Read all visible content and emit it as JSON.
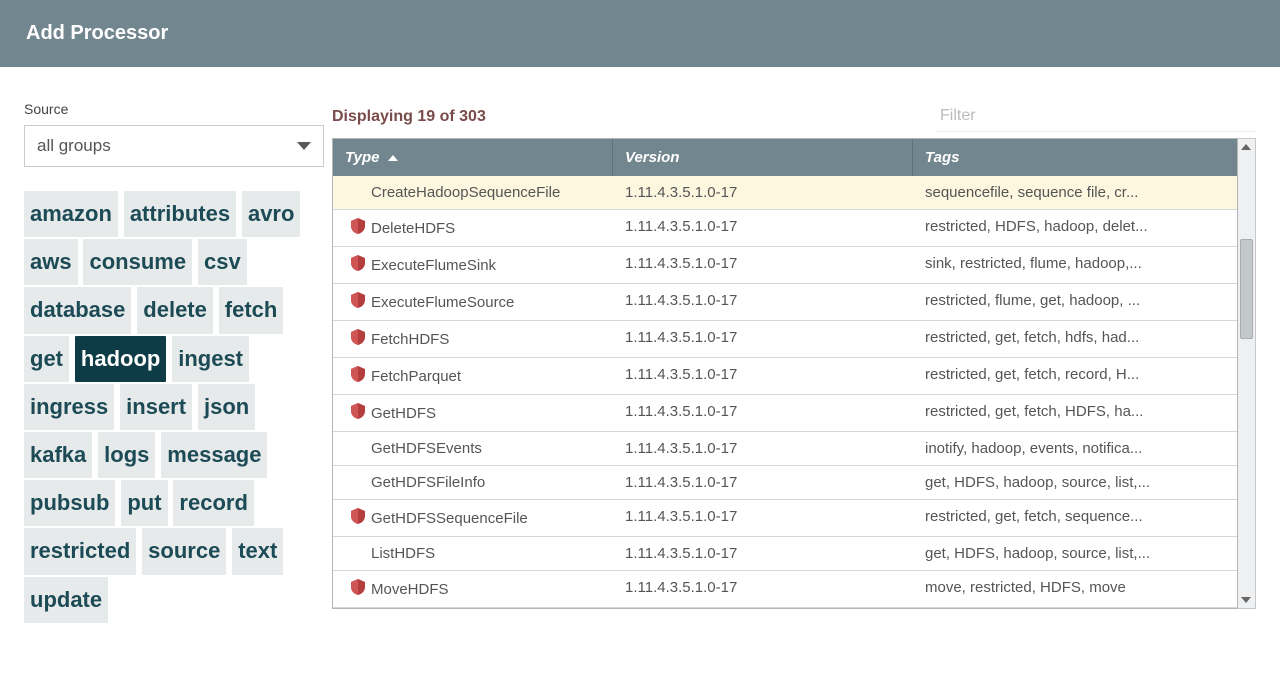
{
  "header": {
    "title": "Add Processor"
  },
  "source": {
    "label": "Source",
    "selected": "all groups"
  },
  "tag_cloud": [
    {
      "label": "amazon",
      "selected": false
    },
    {
      "label": "attributes",
      "selected": false
    },
    {
      "label": "avro",
      "selected": false
    },
    {
      "label": "aws",
      "selected": false
    },
    {
      "label": "consume",
      "selected": false
    },
    {
      "label": "csv",
      "selected": false
    },
    {
      "label": "database",
      "selected": false
    },
    {
      "label": "delete",
      "selected": false
    },
    {
      "label": "fetch",
      "selected": false
    },
    {
      "label": "get",
      "selected": false
    },
    {
      "label": "hadoop",
      "selected": true
    },
    {
      "label": "ingest",
      "selected": false
    },
    {
      "label": "ingress",
      "selected": false
    },
    {
      "label": "insert",
      "selected": false
    },
    {
      "label": "json",
      "selected": false
    },
    {
      "label": "kafka",
      "selected": false
    },
    {
      "label": "logs",
      "selected": false
    },
    {
      "label": "message",
      "selected": false
    },
    {
      "label": "pubsub",
      "selected": false
    },
    {
      "label": "put",
      "selected": false
    },
    {
      "label": "record",
      "selected": false
    },
    {
      "label": "restricted",
      "selected": false
    },
    {
      "label": "source",
      "selected": false
    },
    {
      "label": "text",
      "selected": false
    },
    {
      "label": "update",
      "selected": false
    }
  ],
  "displaying": "Displaying 19 of 303",
  "filter": {
    "placeholder": "Filter",
    "value": ""
  },
  "columns": {
    "type": "Type",
    "version": "Version",
    "tags": "Tags"
  },
  "rows": [
    {
      "restricted": false,
      "type": "CreateHadoopSequenceFile",
      "version": "1.11.4.3.5.1.0-17",
      "tags": "sequencefile, sequence file, cr...",
      "selected": true
    },
    {
      "restricted": true,
      "type": "DeleteHDFS",
      "version": "1.11.4.3.5.1.0-17",
      "tags": "restricted, HDFS, hadoop, delet...",
      "selected": false
    },
    {
      "restricted": true,
      "type": "ExecuteFlumeSink",
      "version": "1.11.4.3.5.1.0-17",
      "tags": "sink, restricted, flume, hadoop,...",
      "selected": false
    },
    {
      "restricted": true,
      "type": "ExecuteFlumeSource",
      "version": "1.11.4.3.5.1.0-17",
      "tags": "restricted, flume, get, hadoop, ...",
      "selected": false
    },
    {
      "restricted": true,
      "type": "FetchHDFS",
      "version": "1.11.4.3.5.1.0-17",
      "tags": "restricted, get, fetch, hdfs, had...",
      "selected": false
    },
    {
      "restricted": true,
      "type": "FetchParquet",
      "version": "1.11.4.3.5.1.0-17",
      "tags": "restricted, get, fetch, record, H...",
      "selected": false
    },
    {
      "restricted": true,
      "type": "GetHDFS",
      "version": "1.11.4.3.5.1.0-17",
      "tags": "restricted, get, fetch, HDFS, ha...",
      "selected": false
    },
    {
      "restricted": false,
      "type": "GetHDFSEvents",
      "version": "1.11.4.3.5.1.0-17",
      "tags": "inotify, hadoop, events, notifica...",
      "selected": false
    },
    {
      "restricted": false,
      "type": "GetHDFSFileInfo",
      "version": "1.11.4.3.5.1.0-17",
      "tags": "get, HDFS, hadoop, source, list,...",
      "selected": false
    },
    {
      "restricted": true,
      "type": "GetHDFSSequenceFile",
      "version": "1.11.4.3.5.1.0-17",
      "tags": "restricted, get, fetch, sequence...",
      "selected": false
    },
    {
      "restricted": false,
      "type": "ListHDFS",
      "version": "1.11.4.3.5.1.0-17",
      "tags": "get, HDFS, hadoop, source, list,...",
      "selected": false
    },
    {
      "restricted": true,
      "type": "MoveHDFS",
      "version": "1.11.4.3.5.1.0-17",
      "tags": "move, restricted, HDFS, move",
      "selected": false
    }
  ]
}
